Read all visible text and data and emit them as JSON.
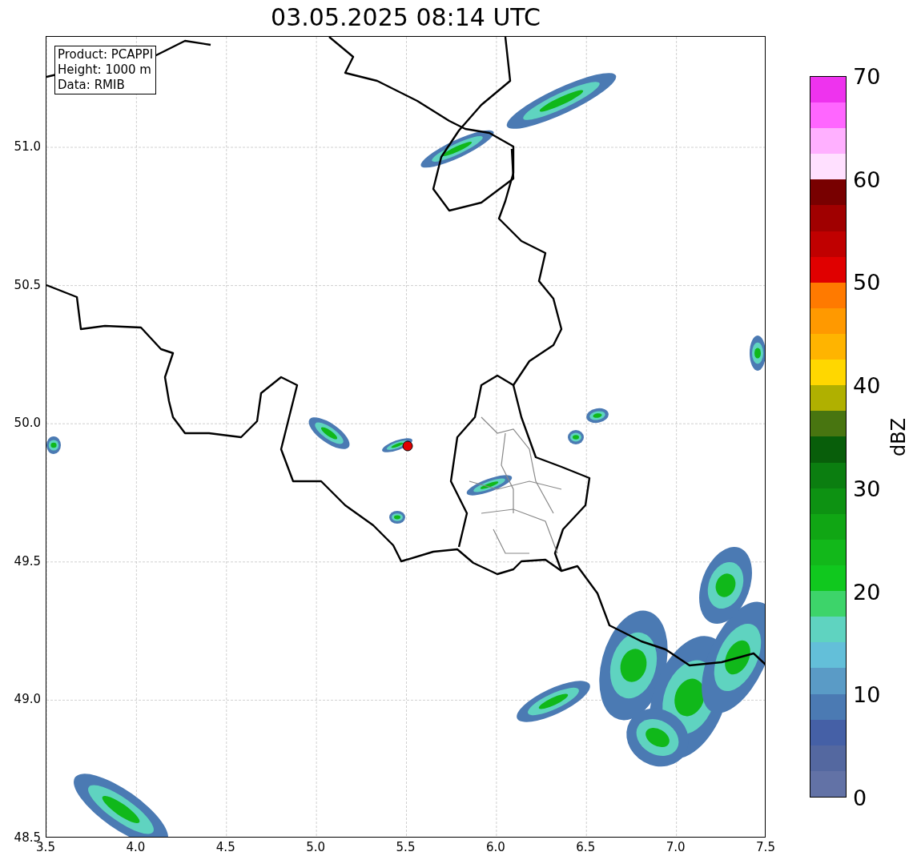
{
  "title": "03.05.2025 08:14 UTC",
  "info_box": [
    "Product: PCAPPI",
    "Height: 1000 m",
    "Data: RMIB"
  ],
  "x_ticks": [
    "3.5",
    "4.0",
    "4.5",
    "5.0",
    "5.5",
    "6.0",
    "6.5",
    "7.0",
    "7.5"
  ],
  "y_ticks": [
    "51.0",
    "50.5",
    "50.0",
    "49.5",
    "49.0",
    "48.5"
  ],
  "colorbar": {
    "label": "dBZ",
    "ticks": [
      "70",
      "60",
      "50",
      "40",
      "30",
      "20",
      "10",
      "0"
    ],
    "bins": [
      {
        "color": "#6272a6"
      },
      {
        "color": "#5468a0"
      },
      {
        "color": "#4560a6"
      },
      {
        "color": "#4b7ab3"
      },
      {
        "color": "#5a9bc6"
      },
      {
        "color": "#63bfd9"
      },
      {
        "color": "#5fd3c0"
      },
      {
        "color": "#3dd46a"
      },
      {
        "color": "#10c81e"
      },
      {
        "color": "#12b81a"
      },
      {
        "color": "#10a614"
      },
      {
        "color": "#0d9212"
      },
      {
        "color": "#0b7e10"
      },
      {
        "color": "#085e0a"
      },
      {
        "color": "#487510"
      },
      {
        "color": "#b0b000"
      },
      {
        "color": "#ffd700"
      },
      {
        "color": "#ffb400"
      },
      {
        "color": "#ff9900"
      },
      {
        "color": "#ff7a00"
      },
      {
        "color": "#e00000"
      },
      {
        "color": "#c00000"
      },
      {
        "color": "#a00000"
      },
      {
        "color": "#780000"
      },
      {
        "color": "#ffe0ff"
      },
      {
        "color": "#ffb0ff"
      },
      {
        "color": "#ff66ff"
      },
      {
        "color": "#ee33ee"
      }
    ]
  }
}
